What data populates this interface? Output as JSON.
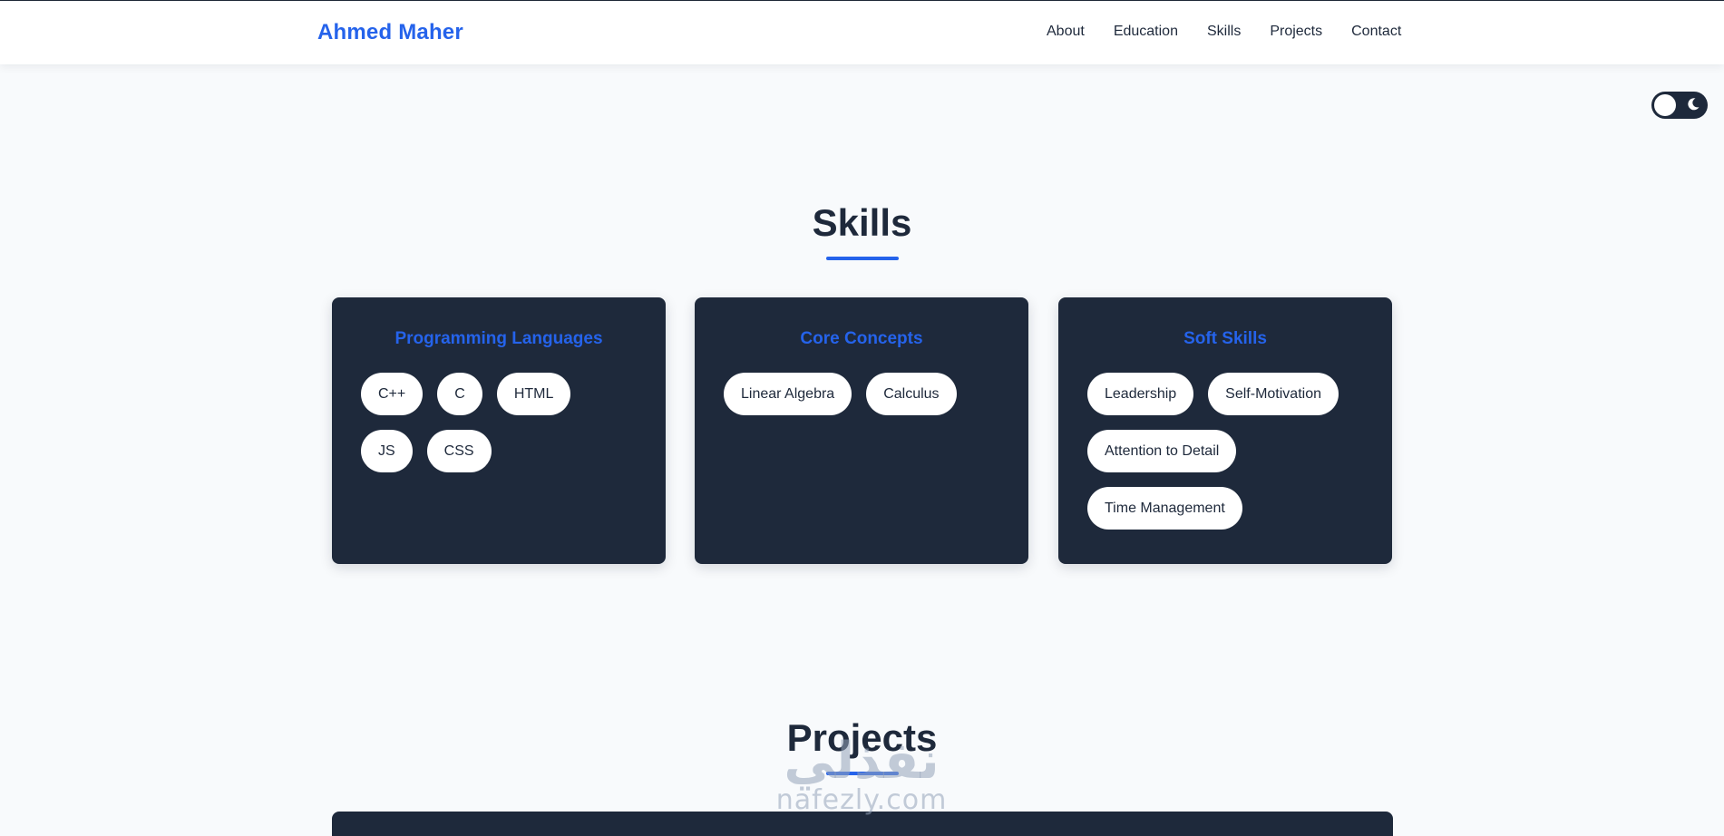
{
  "header": {
    "brand": "Ahmed Maher",
    "nav_items": [
      {
        "label": "About"
      },
      {
        "label": "Education"
      },
      {
        "label": "Skills"
      },
      {
        "label": "Projects"
      },
      {
        "label": "Contact"
      }
    ]
  },
  "theme_toggle": {
    "icon": "moon-icon",
    "state": "light"
  },
  "skills": {
    "title": "Skills",
    "categories": [
      {
        "title": "Programming Languages",
        "items": [
          "C++",
          "C",
          "HTML",
          "JS",
          "CSS"
        ]
      },
      {
        "title": "Core Concepts",
        "items": [
          "Linear Algebra",
          "Calculus"
        ]
      },
      {
        "title": "Soft Skills",
        "items": [
          "Leadership",
          "Self-Motivation",
          "Attention to Detail",
          "Time Management"
        ]
      }
    ]
  },
  "projects": {
    "title": "Projects"
  },
  "watermark": {
    "arabic": "نفذلي",
    "latin": "nafezly.com"
  },
  "colors": {
    "accent": "#2563eb",
    "card_bg": "#1e293b",
    "page_bg": "#f8fafc",
    "text": "#1e293b"
  }
}
